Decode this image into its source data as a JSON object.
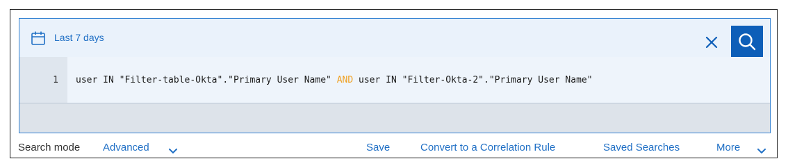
{
  "date_range": {
    "icon": "calendar-icon",
    "label": "Last 7 days"
  },
  "query": {
    "line_number": "1",
    "part1": "user IN \"Filter-table-Okta\".\"Primary User Name\" ",
    "keyword": "AND",
    "part2": " user IN \"Filter-Okta-2\".\"Primary User Name\""
  },
  "actions": {
    "clear_icon": "close-icon",
    "search_icon": "search-icon"
  },
  "bottom": {
    "search_mode_label": "Search mode",
    "search_mode_value": "Advanced",
    "save": "Save",
    "convert": "Convert to a Correlation Rule",
    "saved_searches": "Saved Searches",
    "more": "More"
  },
  "colors": {
    "accent": "#1f6fc5",
    "search_button": "#0d5eb8",
    "keyword": "#f0a020",
    "editor_bg": "#eaf2fb"
  }
}
